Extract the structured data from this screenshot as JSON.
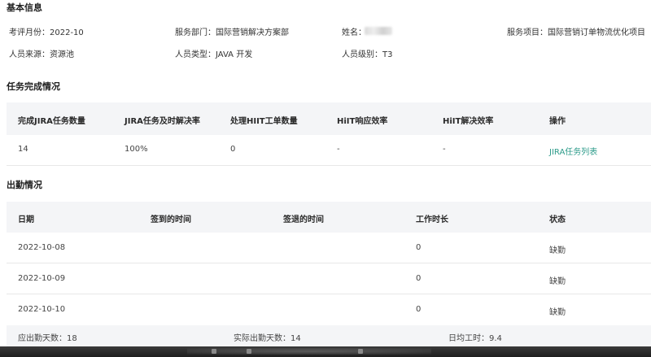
{
  "basic": {
    "title": "基本信息",
    "review_month_label": "考评月份：",
    "review_month_value": "2022-10",
    "dept_label": "服务部门：",
    "dept_value": "国际营销解决方案部",
    "name_label": "姓名：",
    "project_label": "服务项目：",
    "project_value": "国际营销订单物流优化项目",
    "source_label": "人员来源：",
    "source_value": "资源池",
    "type_label": "人员类型：",
    "type_value": "JAVA 开发",
    "level_label": "人员级别：",
    "level_value": "T3"
  },
  "tasks": {
    "title": "任务完成情况",
    "headers": [
      "完成JIRA任务数量",
      "JIRA任务及时解决率",
      "处理HIIT工单数量",
      "HiIT响应效率",
      "HiIT解决效率",
      "操作"
    ],
    "row": [
      "14",
      "100%",
      "0",
      "-",
      "-"
    ],
    "action_link": "JIRA任务列表"
  },
  "attendance": {
    "title": "出勤情况",
    "headers": [
      "日期",
      "签到的时间",
      "签退的时间",
      "工作时长",
      "状态"
    ],
    "rows": [
      {
        "date": "2022-10-08",
        "checkin": "",
        "checkout": "",
        "hours": "0",
        "status": "缺勤"
      },
      {
        "date": "2022-10-09",
        "checkin": "",
        "checkout": "",
        "hours": "0",
        "status": "缺勤"
      },
      {
        "date": "2022-10-10",
        "checkin": "",
        "checkout": "",
        "hours": "0",
        "status": "缺勤"
      }
    ],
    "summary": {
      "expected_label": "应出勤天数：",
      "expected_value": "18",
      "actual_label": "实际出勤天数：",
      "actual_value": "14",
      "avg_label": "日均工时：",
      "avg_value": "9.4"
    }
  },
  "colors": {
    "link": "#2d9b8a",
    "header_bg": "#f4f5f7"
  }
}
